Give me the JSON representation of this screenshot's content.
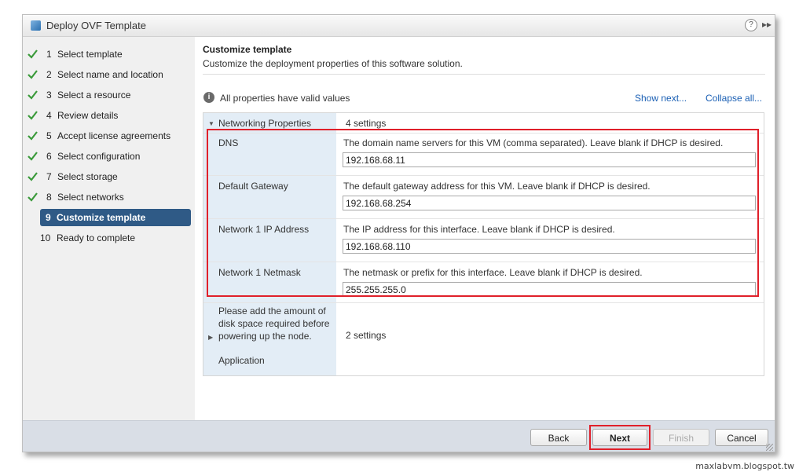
{
  "window": {
    "title": "Deploy OVF Template",
    "help": "?"
  },
  "steps": [
    {
      "num": "1",
      "label": "Select template"
    },
    {
      "num": "2",
      "label": "Select name and location"
    },
    {
      "num": "3",
      "label": "Select a resource"
    },
    {
      "num": "4",
      "label": "Review details"
    },
    {
      "num": "5",
      "label": "Accept license agreements"
    },
    {
      "num": "6",
      "label": "Select configuration"
    },
    {
      "num": "7",
      "label": "Select storage"
    },
    {
      "num": "8",
      "label": "Select networks"
    },
    {
      "num": "9",
      "label": "Customize template"
    },
    {
      "num": "10",
      "label": "Ready to complete"
    }
  ],
  "main": {
    "title": "Customize template",
    "subtitle": "Customize the deployment properties of this software solution.",
    "info": "All properties have valid values",
    "show_next": "Show next...",
    "collapse_all": "Collapse all..."
  },
  "networking": {
    "label": "Networking Properties",
    "count": "4 settings",
    "props": [
      {
        "label": "DNS",
        "desc": "The domain name servers for this VM (comma separated). Leave blank if DHCP is desired.",
        "value": "192.168.68.11"
      },
      {
        "label": "Default Gateway",
        "desc": "The default gateway address for this VM. Leave blank if DHCP is desired.",
        "value": "192.168.68.254"
      },
      {
        "label": "Network 1 IP Address",
        "desc": "The IP address for this interface. Leave blank if DHCP is desired.",
        "value": "192.168.68.110"
      },
      {
        "label": "Network 1 Netmask",
        "desc": "The netmask or prefix for this interface. Leave blank if DHCP is desired.",
        "value": "255.255.255.0"
      }
    ]
  },
  "application": {
    "label": "Please add the amount of disk space required before powering up the node.",
    "label2": "Application",
    "count": "2 settings"
  },
  "footer": {
    "back": "Back",
    "next": "Next",
    "finish": "Finish",
    "cancel": "Cancel"
  },
  "watermark": "maxlabvm.blogspot.tw",
  "colors": {
    "active_step": "#2f5a86",
    "highlight": "#e0202a",
    "link": "#1a5fb4",
    "check": "#3a9a3a"
  }
}
